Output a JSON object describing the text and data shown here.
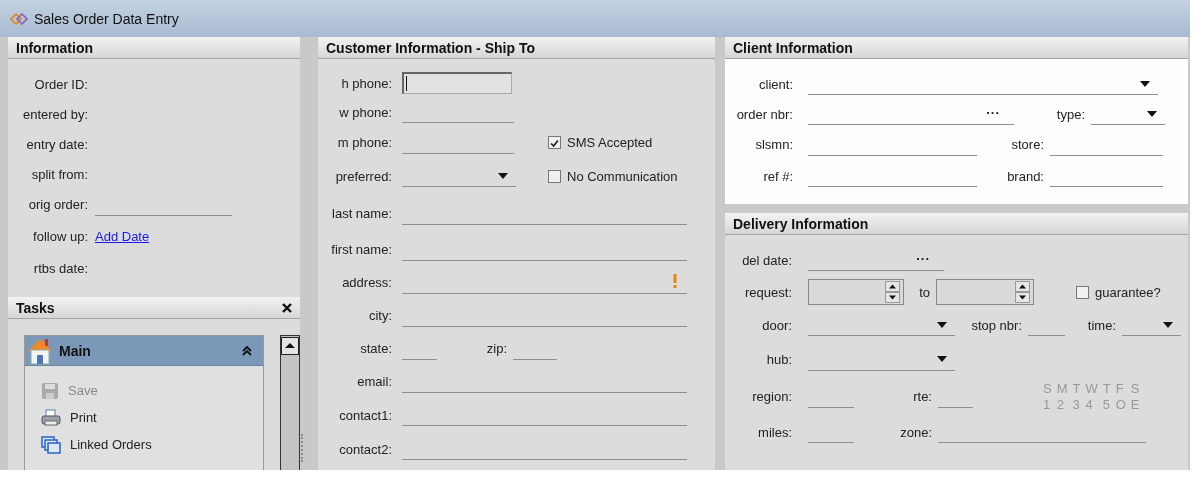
{
  "window": {
    "title": "Sales Order Data Entry"
  },
  "information": {
    "title": "Information",
    "rows": [
      {
        "fields": [
          {
            "label": "Order ID:",
            "kind": "none"
          }
        ]
      },
      {
        "fields": [
          {
            "label": "entered by:",
            "kind": "none"
          }
        ]
      },
      {
        "fields": [
          {
            "label": "entry date:",
            "kind": "none"
          }
        ]
      },
      {
        "fields": [
          {
            "label": "split from:",
            "kind": "none"
          }
        ]
      },
      {
        "fields": [
          {
            "label": "orig order:",
            "kind": "line"
          }
        ]
      },
      {
        "fields": [
          {
            "label": "follow up:",
            "kind": "link",
            "link": "Add Date"
          }
        ]
      },
      {
        "fields": [
          {
            "label": "rtbs date:",
            "kind": "none"
          }
        ]
      }
    ]
  },
  "tasks": {
    "title": "Tasks",
    "group": {
      "title": "Main",
      "expanded": true,
      "items": [
        {
          "label": "Save",
          "kind": "floppy",
          "disabled": true
        },
        {
          "label": "Print",
          "kind": "printer",
          "disabled": false
        },
        {
          "label": "Linked Orders",
          "kind": "windows",
          "disabled": false
        }
      ]
    }
  },
  "customer": {
    "title": "Customer Information - Ship To",
    "rows": [
      {
        "fields": [
          {
            "label": "h phone:",
            "kind": "input",
            "focused": true
          }
        ]
      },
      {
        "fields": [
          {
            "label": "w phone:",
            "kind": "line"
          }
        ]
      },
      {
        "fields": [
          {
            "label": "m phone:",
            "kind": "line"
          },
          {
            "label": "SMS Accepted",
            "kind": "checkbox",
            "checked": true
          }
        ]
      },
      {
        "fields": [
          {
            "label": "preferred:",
            "kind": "dropdown"
          },
          {
            "label": "No Communication",
            "kind": "checkbox",
            "checked": false
          }
        ]
      },
      {
        "fields": [
          {
            "label": "last name:",
            "kind": "line"
          }
        ]
      },
      {
        "fields": [
          {
            "label": "first name:",
            "kind": "line"
          }
        ]
      },
      {
        "fields": [
          {
            "label": "address:",
            "kind": "line",
            "warning": true
          }
        ]
      },
      {
        "fields": [
          {
            "label": "city:",
            "kind": "line"
          }
        ]
      },
      {
        "fields": [
          {
            "label": "state:",
            "kind": "line"
          },
          {
            "label": "zip:",
            "kind": "line"
          }
        ]
      },
      {
        "fields": [
          {
            "label": "email:",
            "kind": "line"
          }
        ]
      },
      {
        "fields": [
          {
            "label": "contact1:",
            "kind": "line"
          }
        ]
      },
      {
        "fields": [
          {
            "label": "contact2:",
            "kind": "line"
          }
        ]
      }
    ]
  },
  "client": {
    "title": "Client Information",
    "rows": [
      {
        "fields": [
          {
            "label": "client:",
            "kind": "dropdown"
          }
        ]
      },
      {
        "fields": [
          {
            "label": "order nbr:",
            "kind": "picker",
            "button": "..."
          },
          {
            "label": "type:",
            "kind": "dropdown"
          }
        ]
      },
      {
        "fields": [
          {
            "label": "slsmn:",
            "kind": "line"
          },
          {
            "label": "store:",
            "kind": "line"
          }
        ]
      },
      {
        "fields": [
          {
            "label": "ref #:",
            "kind": "line"
          },
          {
            "label": "brand:",
            "kind": "line"
          }
        ]
      }
    ]
  },
  "delivery": {
    "title": "Delivery Information",
    "rows": [
      {
        "fields": [
          {
            "label": "del date:",
            "kind": "picker",
            "button": "..."
          }
        ]
      },
      {
        "fields": [
          {
            "label": "request:",
            "kind": "spin"
          },
          {
            "label": "to",
            "kind": "spin"
          },
          {
            "label": "guarantee?",
            "kind": "checkbox",
            "checked": false
          }
        ]
      },
      {
        "fields": [
          {
            "label": "door:",
            "kind": "dropdown"
          },
          {
            "label": "stop nbr:",
            "kind": "line"
          },
          {
            "label": "time:",
            "kind": "dropdown"
          }
        ]
      },
      {
        "fields": [
          {
            "label": "hub:",
            "kind": "dropdown"
          }
        ]
      },
      {
        "fields": [
          {
            "label": "region:",
            "kind": "line"
          },
          {
            "label": "rte:",
            "kind": "line"
          },
          {
            "kind": "days",
            "letters": [
              "S",
              "M",
              "T",
              "W",
              "T",
              "F",
              "S"
            ],
            "codes": [
              "1",
              "2",
              "3",
              "4",
              "5",
              "O",
              "E"
            ]
          }
        ]
      },
      {
        "fields": [
          {
            "label": "miles:",
            "kind": "line"
          },
          {
            "label": "zone:",
            "kind": "line"
          }
        ]
      }
    ]
  }
}
